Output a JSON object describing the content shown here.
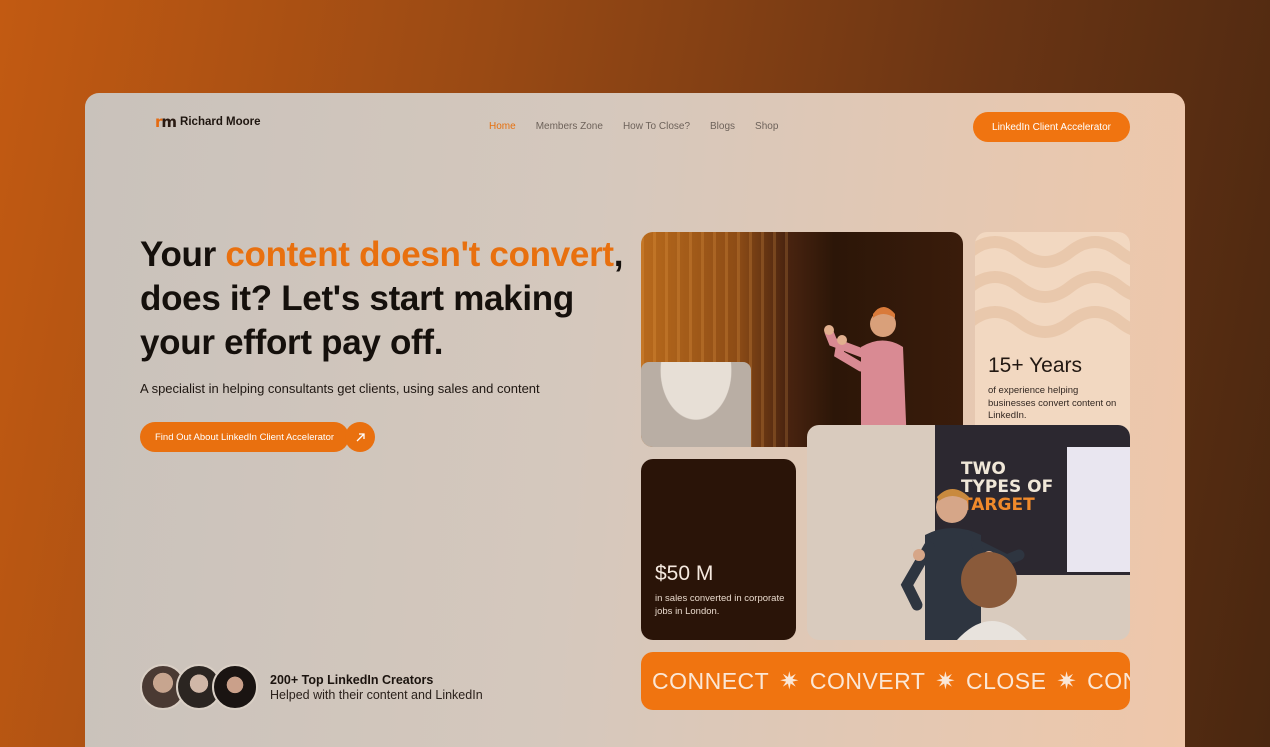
{
  "header": {
    "logo_mark": "rm",
    "logo_text": "Richard Moore",
    "nav": [
      "Home",
      "Members Zone",
      "How To Close?",
      "Blogs",
      "Shop"
    ],
    "active_nav": "Home",
    "cta_label": "LinkedIn Client Accelerator"
  },
  "hero": {
    "headline_part1": "Your ",
    "headline_highlight": "content doesn't convert",
    "headline_part2": ", does it? Let's start making your effort pay off.",
    "subtitle": "A specialist in helping consultants get clients, using sales and content",
    "cta_label": "Find Out About LinkedIn Client Accelerator",
    "cta_icon": "arrow-up-right-icon"
  },
  "creators": {
    "title": "200+ Top LinkedIn Creators",
    "subtitle": "Helped with their content and LinkedIn"
  },
  "stats": {
    "years_value": "15+ Years",
    "years_desc": "of experience helping businesses convert content on LinkedIn.",
    "money_value": "$50 M",
    "money_desc": "in sales converted in corporate jobs in London."
  },
  "photo2": {
    "screen_line1": "TWO",
    "screen_line2": "TYPES OF",
    "screen_line3": "TARGET"
  },
  "banner": {
    "words": [
      "CONNECT",
      "CONVERT",
      "CLOSE",
      "CONNE"
    ]
  },
  "colors": {
    "accent": "#f07410",
    "dark": "#2a1408",
    "cream": "#f2d8c1"
  }
}
